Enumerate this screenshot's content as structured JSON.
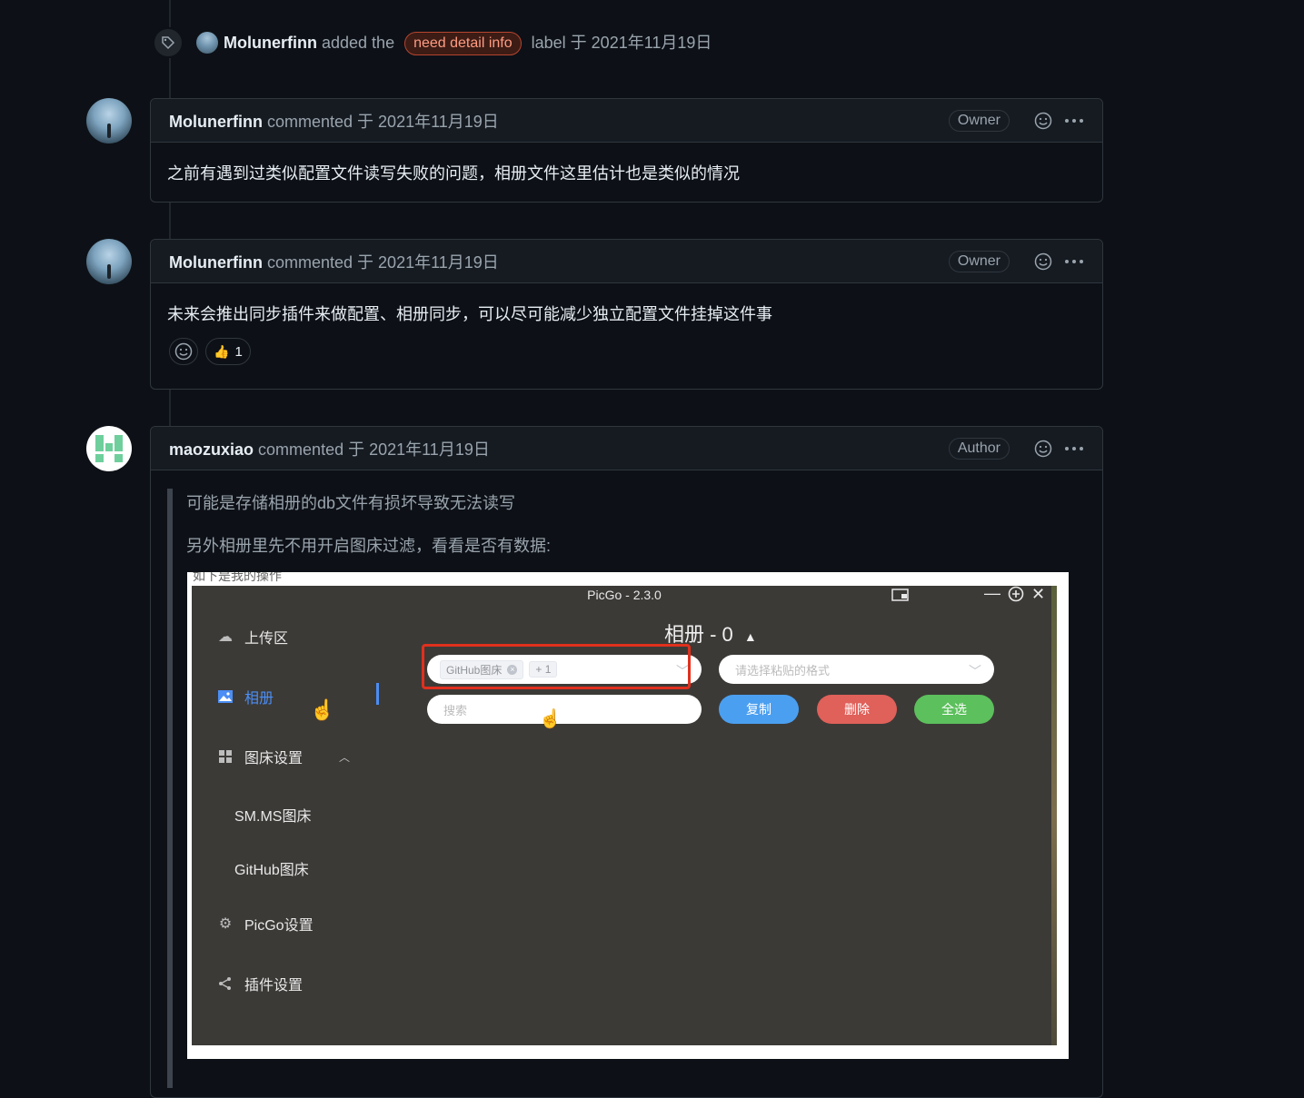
{
  "event": {
    "user": "Molunerfinn",
    "action": "added the",
    "label": "need detail info",
    "suffix": "label 于 2021年11月19日"
  },
  "comments": [
    {
      "author": "Molunerfinn",
      "meta": "commented 于 2021年11月19日",
      "role": "Owner",
      "body": "之前有遇到过类似配置文件读写失败的问题，相册文件这里估计也是类似的情况"
    },
    {
      "author": "Molunerfinn",
      "meta": "commented 于 2021年11月19日",
      "role": "Owner",
      "body": "未来会推出同步插件来做配置、相册同步，可以尽可能减少独立配置文件挂掉这件事",
      "reactions": [
        {
          "icon": "thumbs-up",
          "emoji": "👍",
          "count": "1"
        }
      ]
    },
    {
      "author": "maozuxiao",
      "meta": "commented 于 2021年11月19日",
      "role": "Author",
      "quote": [
        "可能是存储相册的db文件有损坏导致无法读写",
        "另外相册里先不用开启图床过滤，看看是否有数据:"
      ]
    }
  ],
  "screenshot": {
    "caption": "如下是我的操作",
    "app_title": "PicGo - 2.3.0",
    "sidebar": {
      "upload": "上传区",
      "album": "相册",
      "picbed_settings": "图床设置",
      "smms": "SM.MS图床",
      "github": "GitHub图床",
      "picgo_settings": "PicGo设置",
      "plugin_settings": "插件设置"
    },
    "album_title": "相册 - 0",
    "filter_tag": "GitHub图床",
    "filter_more": "+ 1",
    "format_placeholder": "请选择粘贴的格式",
    "search_placeholder": "搜索",
    "buttons": {
      "copy": "复制",
      "delete": "删除",
      "select_all": "全选"
    },
    "colors": {
      "copy": "#4b9ff0",
      "delete": "#e0605a",
      "select_all": "#5cc05c"
    }
  }
}
